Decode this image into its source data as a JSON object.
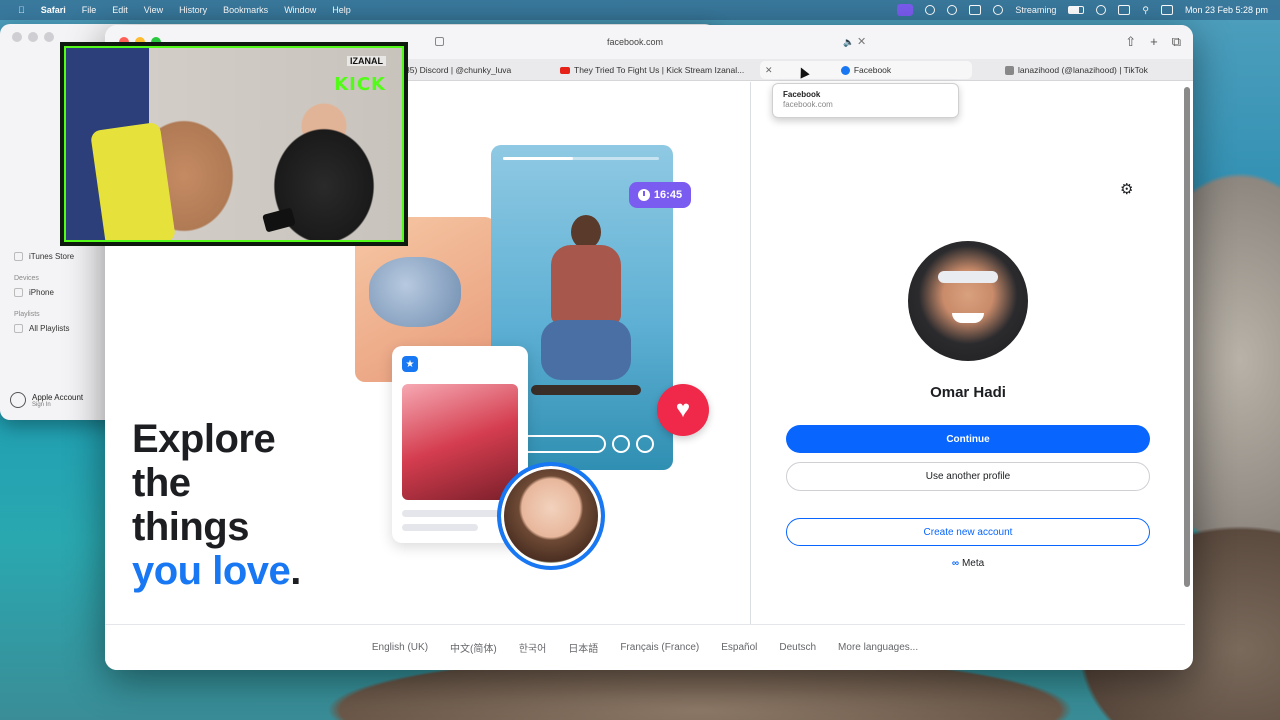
{
  "menubar": {
    "app": "Safari",
    "items": [
      "File",
      "Edit",
      "View",
      "History",
      "Bookmarks",
      "Window",
      "Help"
    ],
    "streaming_label": "Streaming",
    "datetime": "Mon 23 Feb  5:28 pm"
  },
  "music": {
    "sidebar": {
      "store_items": [
        "iTunes Store"
      ],
      "devices_heading": "Devices",
      "devices": [
        "iPhone"
      ],
      "playlists_heading": "Playlists",
      "playlists": [
        "All Playlists"
      ]
    },
    "account": {
      "name": "Apple Account",
      "action": "Sign In"
    }
  },
  "safari": {
    "url": "facebook.com",
    "tabs": [
      {
        "label": "85) Discord | @chunky_luva"
      },
      {
        "label": "They Tried To Fight Us | Kick Stream Izanal..."
      },
      {
        "label": "Facebook"
      },
      {
        "label": "lanazihood (@lanazihood) | TikTok"
      }
    ],
    "tooltip": {
      "title": "Facebook",
      "subtitle": "facebook.com"
    }
  },
  "page": {
    "headline": {
      "line1": "Explore",
      "line2": "the",
      "line3": "things",
      "line4_blue": "you love",
      "period": "."
    },
    "time_badge": "16:45",
    "profile_name": "Omar Hadi",
    "continue_label": "Continue",
    "other_profile_label": "Use another profile",
    "create_account_label": "Create new account",
    "meta_label": "Meta",
    "languages": [
      "English (UK)",
      "中文(简体)",
      "한국어",
      "日本語",
      "Français (France)",
      "Español",
      "Deutsch",
      "More languages..."
    ]
  },
  "pip": {
    "handle": "IZANAL",
    "brand": "KICK"
  }
}
